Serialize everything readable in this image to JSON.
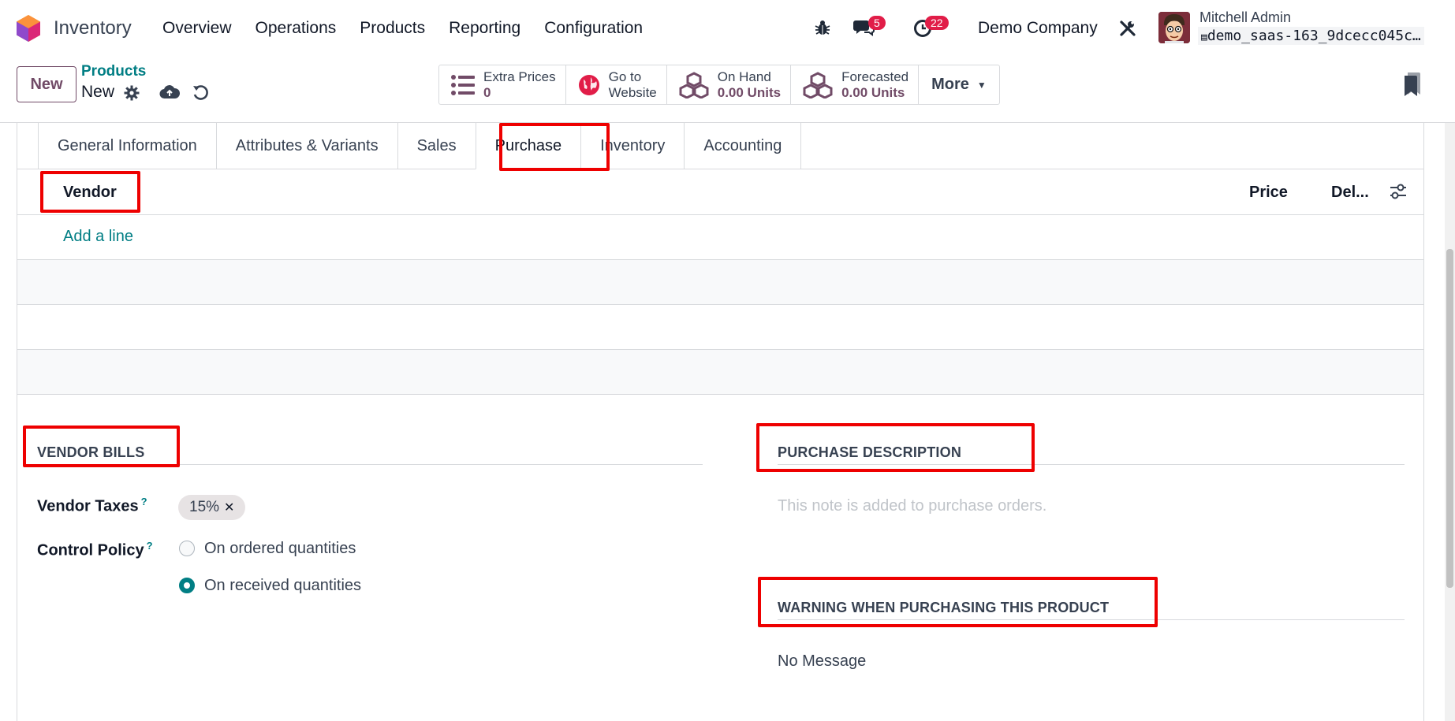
{
  "navbar": {
    "app_name": "Inventory",
    "menu": [
      "Overview",
      "Operations",
      "Products",
      "Reporting",
      "Configuration"
    ],
    "messages_count": "5",
    "activities_count": "22",
    "company": "Demo Company",
    "user_name": "Mitchell Admin",
    "database": "demo_saas-163_9dcecc045c…"
  },
  "control": {
    "new_label": "New",
    "breadcrumb_parent": "Products",
    "breadcrumb_current": "New",
    "smart_buttons": [
      {
        "title": "Extra Prices",
        "value": "0",
        "icon": "list-icon"
      },
      {
        "title": "Go to",
        "value": "Website",
        "icon": "globe-icon"
      },
      {
        "title": "On Hand",
        "value": "0.00 Units",
        "icon": "cubes-icon"
      },
      {
        "title": "Forecasted",
        "value": "0.00 Units",
        "icon": "cubes-icon"
      }
    ],
    "more_label": "More"
  },
  "tabs": [
    "General Information",
    "Attributes & Variants",
    "Sales",
    "Purchase",
    "Inventory",
    "Accounting"
  ],
  "active_tab": "Purchase",
  "vendor_table": {
    "columns": {
      "vendor": "Vendor",
      "price": "Price",
      "delivery": "Del..."
    },
    "add_line": "Add a line"
  },
  "vendor_bills": {
    "title": "VENDOR BILLS",
    "vendor_taxes_label": "Vendor Taxes",
    "vendor_taxes_tag": "15%",
    "help_mark": "?",
    "control_policy_label": "Control Policy",
    "policy_options": [
      "On ordered quantities",
      "On received quantities"
    ],
    "selected_policy": "On received quantities"
  },
  "purchase_description": {
    "title": "PURCHASE DESCRIPTION",
    "placeholder": "This note is added to purchase orders."
  },
  "purchase_warning": {
    "title": "WARNING WHEN PURCHASING THIS PRODUCT",
    "value": "No Message"
  },
  "colors": {
    "primary": "#714b67",
    "accent": "#017e84",
    "highlight": "#ee0000",
    "badge": "#e11d48"
  }
}
